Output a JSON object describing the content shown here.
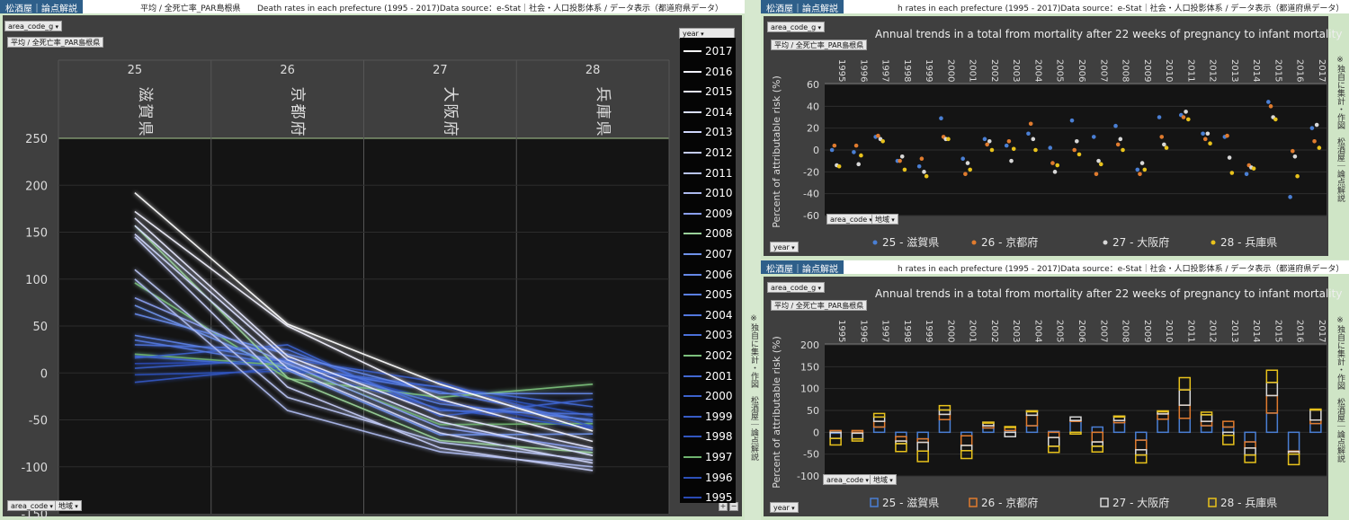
{
  "brand": "松酒屋｜論点解説",
  "left": {
    "header_mid": "平均 / 全死亡率_PAR島根県",
    "header_right": "Death rates in each prefecture (1995 - 2017)Data source：e-Stat｜社会・人口投影体系 / データ表示（都道府県データ）",
    "filter_label": "area_code_g",
    "subtitle_pill": "平均 / 全死亡率_PAR島根県",
    "year_dd": "year",
    "bottom_pill1": "area_code",
    "bottom_pill2": "地域",
    "plus": "+",
    "minus": "−",
    "side_text": "※独自に集計・作図　松酒屋｜論点解説"
  },
  "right_top": {
    "header_right": "h rates in each prefecture (1995 - 2017)Data source：e-Stat｜社会・人口投影体系 / データ表示（都道府県データ）",
    "filter_label": "area_code_g",
    "subtitle_pill": "平均 / 全死亡率_PAR島根県",
    "title": "Annual trends in a total from mortality after 22 weeks of pregnancy to infant mortality",
    "ylabel": "Percent of attributable risk (%)",
    "year_dd": "year",
    "pill1": "area_code",
    "pill2": "地域",
    "side_text": "※独自に集計・作図　松酒屋｜論点解説"
  },
  "right_bottom": {
    "header_right": "h rates in each prefecture (1995 - 2017)Data source：e-Stat｜社会・人口投影体系 / データ表示（都道府県データ）",
    "filter_label": "area_code_g",
    "subtitle_pill": "平均 / 全死亡率_PAR島根県",
    "title": "Annual trends in a total from mortality after 22 weeks of pregnancy to infant mortality",
    "ylabel": "Percent of attributable risk (%)",
    "year_dd": "year",
    "pill1": "area_code",
    "pill2": "地域",
    "side_text": "※独自に集計・作図　松酒屋｜論点解説"
  },
  "colors": {
    "shiga": "#4a7fd4",
    "kyoto": "#e07b2e",
    "osaka": "#d8d8d8",
    "hyogo": "#e8c21c"
  },
  "chart_data": [
    {
      "type": "line",
      "categories": [
        "25",
        "26",
        "27",
        "28"
      ],
      "category_names": [
        "滋賀県",
        "京都府",
        "大阪府",
        "兵庫県"
      ],
      "ylim": [
        -150,
        250
      ],
      "yticks": [
        -150,
        -100,
        -50,
        0,
        50,
        100,
        150,
        200,
        250
      ],
      "legend_title": "year",
      "series": [
        {
          "name": "2017",
          "color": "#ffffff",
          "values": [
            192,
            52,
            -12,
            -62
          ]
        },
        {
          "name": "2016",
          "color": "#f2f2ff",
          "values": [
            172,
            50,
            -28,
            -73
          ]
        },
        {
          "name": "2015",
          "color": "#e6e8ff",
          "values": [
            165,
            18,
            -44,
            -80
          ]
        },
        {
          "name": "2014",
          "color": "#dadfff",
          "values": [
            157,
            14,
            -52,
            -88
          ]
        },
        {
          "name": "2013",
          "color": "#cfd6fb",
          "values": [
            148,
            5,
            -64,
            -96
          ]
        },
        {
          "name": "2012",
          "color": "#c4ccf6",
          "values": [
            145,
            -15,
            -80,
            -104
          ]
        },
        {
          "name": "2011",
          "color": "#b8c3f2",
          "values": [
            110,
            -26,
            -74,
            -93
          ]
        },
        {
          "name": "2010",
          "color": "#adbaee",
          "values": [
            100,
            -40,
            -84,
            -100
          ]
        },
        {
          "name": "2009",
          "color": "#8a9ff0",
          "values": [
            80,
            10,
            -58,
            -82
          ]
        },
        {
          "name": "2008",
          "color": "#9ad29a",
          "values": [
            157,
            -5,
            -72,
            -85
          ]
        },
        {
          "name": "2007",
          "color": "#6f92ea",
          "values": [
            72,
            3,
            -66,
            -65
          ]
        },
        {
          "name": "2006",
          "color": "#6588e6",
          "values": [
            63,
            20,
            -22,
            -22
          ]
        },
        {
          "name": "2005",
          "color": "#5a7fe2",
          "values": [
            40,
            12,
            -33,
            -50
          ]
        },
        {
          "name": "2004",
          "color": "#5277dd",
          "values": [
            35,
            8,
            -20,
            -52
          ]
        },
        {
          "name": "2003",
          "color": "#4b70d8",
          "values": [
            30,
            25,
            -40,
            -44
          ]
        },
        {
          "name": "2002",
          "color": "#7cc07c",
          "values": [
            96,
            -6,
            -26,
            -12
          ]
        },
        {
          "name": "2001",
          "color": "#4268d2",
          "values": [
            18,
            6,
            -15,
            -36
          ]
        },
        {
          "name": "2000",
          "color": "#3c62cc",
          "values": [
            16,
            30,
            -46,
            -28
          ]
        },
        {
          "name": "1999",
          "color": "#375cc6",
          "values": [
            5,
            15,
            -10,
            -57
          ]
        },
        {
          "name": "1998",
          "color": "#3256c0",
          "values": [
            -10,
            6,
            -38,
            -59
          ]
        },
        {
          "name": "1997",
          "color": "#6fb36f",
          "values": [
            20,
            8,
            -55,
            -54
          ]
        },
        {
          "name": "1996",
          "color": "#2d50b9",
          "values": [
            -2,
            2,
            -15,
            -46
          ]
        },
        {
          "name": "1995",
          "color": "#2a4ab3",
          "values": [
            10,
            12,
            -30,
            -58
          ]
        }
      ]
    },
    {
      "type": "scatter",
      "title": "Annual trends in a total from mortality after 22 weeks of pregnancy to infant mortality",
      "ylabel": "Percent of attributable risk (%)",
      "ylim": [
        -60,
        60
      ],
      "yticks": [
        -60,
        -40,
        -20,
        0,
        20,
        40,
        60
      ],
      "categories": [
        "1995",
        "1996",
        "1997",
        "1998",
        "1999",
        "2000",
        "2001",
        "2002",
        "2003",
        "2004",
        "2005",
        "2006",
        "2007",
        "2008",
        "2009",
        "2010",
        "2011",
        "2012",
        "2013",
        "2014",
        "2015",
        "2016",
        "2017"
      ],
      "series": [
        {
          "name": "25 - 滋賀県",
          "color": "#4a7fd4",
          "values": [
            0,
            -2,
            12,
            -10,
            -15,
            29,
            -8,
            10,
            4,
            15,
            2,
            27,
            12,
            22,
            -18,
            30,
            32,
            15,
            12,
            -22,
            44,
            -43,
            20
          ]
        },
        {
          "name": "26 - 京都府",
          "color": "#e07b2e",
          "values": [
            4,
            4,
            13,
            -10,
            -8,
            12,
            -22,
            5,
            8,
            24,
            -12,
            0,
            -22,
            5,
            -22,
            12,
            30,
            10,
            13,
            -14,
            40,
            -1,
            8
          ]
        },
        {
          "name": "27 - 大阪府",
          "color": "#d8d8d8",
          "values": [
            -14,
            -13,
            10,
            -6,
            -20,
            10,
            -12,
            8,
            -10,
            10,
            -20,
            8,
            -10,
            10,
            -12,
            5,
            35,
            15,
            -7,
            -16,
            30,
            -6,
            23
          ]
        },
        {
          "name": "28 - 兵庫県",
          "color": "#e8c21c",
          "values": [
            -15,
            -5,
            8,
            -18,
            -24,
            10,
            -18,
            0,
            1,
            0,
            -14,
            -4,
            -13,
            0,
            -18,
            2,
            28,
            6,
            -21,
            -17,
            28,
            -24,
            2
          ]
        }
      ]
    },
    {
      "type": "bar",
      "title": "Annual trends in a total from mortality after 22 weeks of pregnancy to infant mortality",
      "ylabel": "Percent of attributable risk (%)",
      "ylim": [
        -100,
        200
      ],
      "yticks": [
        -100,
        -50,
        0,
        50,
        100,
        150,
        200
      ],
      "categories": [
        "1995",
        "1996",
        "1997",
        "1998",
        "1999",
        "2000",
        "2001",
        "2002",
        "2003",
        "2004",
        "2005",
        "2006",
        "2007",
        "2008",
        "2009",
        "2010",
        "2011",
        "2012",
        "2013",
        "2014",
        "2015",
        "2016",
        "2017"
      ],
      "series": [
        {
          "name": "25 - 滋賀県",
          "color": "#4a7fd4",
          "values": [
            0,
            -2,
            12,
            -10,
            -15,
            29,
            -8,
            10,
            4,
            15,
            2,
            27,
            12,
            22,
            -18,
            30,
            32,
            15,
            12,
            -22,
            44,
            -43,
            20
          ]
        },
        {
          "name": "26 - 京都府",
          "color": "#e07b2e",
          "values": [
            4,
            4,
            13,
            -10,
            -8,
            12,
            -22,
            5,
            8,
            24,
            -12,
            0,
            -22,
            5,
            -22,
            12,
            30,
            10,
            13,
            -14,
            40,
            -1,
            8
          ]
        },
        {
          "name": "27 - 大阪府",
          "color": "#d8d8d8",
          "values": [
            -14,
            -13,
            10,
            -6,
            -20,
            10,
            -12,
            8,
            -10,
            10,
            -20,
            8,
            -10,
            10,
            -12,
            5,
            35,
            15,
            -7,
            -16,
            30,
            -6,
            23
          ]
        },
        {
          "name": "28 - 兵庫県",
          "color": "#e8c21c",
          "values": [
            -15,
            -5,
            8,
            -18,
            -24,
            10,
            -18,
            0,
            1,
            0,
            -14,
            -4,
            -13,
            0,
            -18,
            2,
            28,
            6,
            -21,
            -17,
            28,
            -24,
            2
          ]
        }
      ]
    }
  ]
}
